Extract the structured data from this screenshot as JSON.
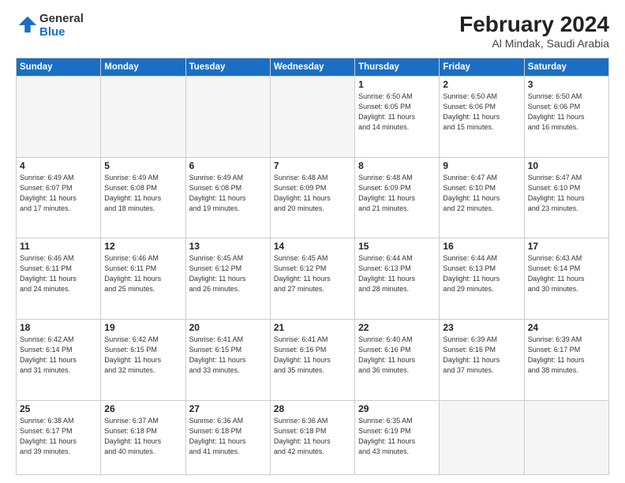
{
  "logo": {
    "general": "General",
    "blue": "Blue"
  },
  "title": "February 2024",
  "location": "Al Mindak, Saudi Arabia",
  "weekdays": [
    "Sunday",
    "Monday",
    "Tuesday",
    "Wednesday",
    "Thursday",
    "Friday",
    "Saturday"
  ],
  "weeks": [
    [
      {
        "day": "",
        "info": ""
      },
      {
        "day": "",
        "info": ""
      },
      {
        "day": "",
        "info": ""
      },
      {
        "day": "",
        "info": ""
      },
      {
        "day": "1",
        "info": "Sunrise: 6:50 AM\nSunset: 6:05 PM\nDaylight: 11 hours\nand 14 minutes."
      },
      {
        "day": "2",
        "info": "Sunrise: 6:50 AM\nSunset: 6:06 PM\nDaylight: 11 hours\nand 15 minutes."
      },
      {
        "day": "3",
        "info": "Sunrise: 6:50 AM\nSunset: 6:06 PM\nDaylight: 11 hours\nand 16 minutes."
      }
    ],
    [
      {
        "day": "4",
        "info": "Sunrise: 6:49 AM\nSunset: 6:07 PM\nDaylight: 11 hours\nand 17 minutes."
      },
      {
        "day": "5",
        "info": "Sunrise: 6:49 AM\nSunset: 6:08 PM\nDaylight: 11 hours\nand 18 minutes."
      },
      {
        "day": "6",
        "info": "Sunrise: 6:49 AM\nSunset: 6:08 PM\nDaylight: 11 hours\nand 19 minutes."
      },
      {
        "day": "7",
        "info": "Sunrise: 6:48 AM\nSunset: 6:09 PM\nDaylight: 11 hours\nand 20 minutes."
      },
      {
        "day": "8",
        "info": "Sunrise: 6:48 AM\nSunset: 6:09 PM\nDaylight: 11 hours\nand 21 minutes."
      },
      {
        "day": "9",
        "info": "Sunrise: 6:47 AM\nSunset: 6:10 PM\nDaylight: 11 hours\nand 22 minutes."
      },
      {
        "day": "10",
        "info": "Sunrise: 6:47 AM\nSunset: 6:10 PM\nDaylight: 11 hours\nand 23 minutes."
      }
    ],
    [
      {
        "day": "11",
        "info": "Sunrise: 6:46 AM\nSunset: 6:11 PM\nDaylight: 11 hours\nand 24 minutes."
      },
      {
        "day": "12",
        "info": "Sunrise: 6:46 AM\nSunset: 6:11 PM\nDaylight: 11 hours\nand 25 minutes."
      },
      {
        "day": "13",
        "info": "Sunrise: 6:45 AM\nSunset: 6:12 PM\nDaylight: 11 hours\nand 26 minutes."
      },
      {
        "day": "14",
        "info": "Sunrise: 6:45 AM\nSunset: 6:12 PM\nDaylight: 11 hours\nand 27 minutes."
      },
      {
        "day": "15",
        "info": "Sunrise: 6:44 AM\nSunset: 6:13 PM\nDaylight: 11 hours\nand 28 minutes."
      },
      {
        "day": "16",
        "info": "Sunrise: 6:44 AM\nSunset: 6:13 PM\nDaylight: 11 hours\nand 29 minutes."
      },
      {
        "day": "17",
        "info": "Sunrise: 6:43 AM\nSunset: 6:14 PM\nDaylight: 11 hours\nand 30 minutes."
      }
    ],
    [
      {
        "day": "18",
        "info": "Sunrise: 6:42 AM\nSunset: 6:14 PM\nDaylight: 11 hours\nand 31 minutes."
      },
      {
        "day": "19",
        "info": "Sunrise: 6:42 AM\nSunset: 6:15 PM\nDaylight: 11 hours\nand 32 minutes."
      },
      {
        "day": "20",
        "info": "Sunrise: 6:41 AM\nSunset: 6:15 PM\nDaylight: 11 hours\nand 33 minutes."
      },
      {
        "day": "21",
        "info": "Sunrise: 6:41 AM\nSunset: 6:16 PM\nDaylight: 11 hours\nand 35 minutes."
      },
      {
        "day": "22",
        "info": "Sunrise: 6:40 AM\nSunset: 6:16 PM\nDaylight: 11 hours\nand 36 minutes."
      },
      {
        "day": "23",
        "info": "Sunrise: 6:39 AM\nSunset: 6:16 PM\nDaylight: 11 hours\nand 37 minutes."
      },
      {
        "day": "24",
        "info": "Sunrise: 6:39 AM\nSunset: 6:17 PM\nDaylight: 11 hours\nand 38 minutes."
      }
    ],
    [
      {
        "day": "25",
        "info": "Sunrise: 6:38 AM\nSunset: 6:17 PM\nDaylight: 11 hours\nand 39 minutes."
      },
      {
        "day": "26",
        "info": "Sunrise: 6:37 AM\nSunset: 6:18 PM\nDaylight: 11 hours\nand 40 minutes."
      },
      {
        "day": "27",
        "info": "Sunrise: 6:36 AM\nSunset: 6:18 PM\nDaylight: 11 hours\nand 41 minutes."
      },
      {
        "day": "28",
        "info": "Sunrise: 6:36 AM\nSunset: 6:18 PM\nDaylight: 11 hours\nand 42 minutes."
      },
      {
        "day": "29",
        "info": "Sunrise: 6:35 AM\nSunset: 6:19 PM\nDaylight: 11 hours\nand 43 minutes."
      },
      {
        "day": "",
        "info": ""
      },
      {
        "day": "",
        "info": ""
      }
    ]
  ]
}
